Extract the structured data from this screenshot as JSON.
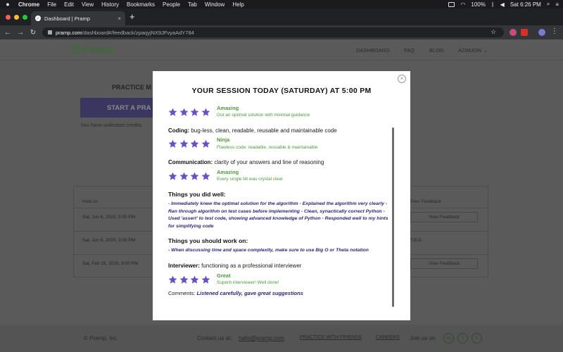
{
  "menubar": {
    "app": "Chrome",
    "items": [
      "File",
      "Edit",
      "View",
      "History",
      "Bookmarks",
      "People",
      "Tab",
      "Window",
      "Help"
    ],
    "battery": "100%",
    "clock": "Sat 6:26 PM"
  },
  "browser": {
    "tab_title": "Dashboard | Pramp",
    "url_host": "pramp.com",
    "url_path": "/dashboard#/feedback/zpaqyjNX9JFvyaAdY784"
  },
  "site": {
    "logo": "Pramp",
    "nav": [
      "DASHBOARD",
      "FAQ",
      "BLOG",
      "AZIMJON"
    ],
    "practice_heading": "PRACTICE M",
    "start_button": "START A PRA",
    "unlimited_text": "You have unlimited credits",
    "table": {
      "headers": [
        "Held on",
        "Peer Feedback"
      ],
      "rows": [
        {
          "date": "Sat, Jun 6, 2020, 5:00 PM",
          "action": "View Feedback"
        },
        {
          "date": "Sat, Jun 6, 2020, 3:00 PM",
          "action": "T.B.D."
        },
        {
          "date": "Sat, Feb 15, 2020, 9:00 PM",
          "action": "View Feedback"
        }
      ]
    },
    "footer": {
      "copyright": "© Pramp, Inc.",
      "contact_label": "Contact us at:",
      "contact_email": "hello@pramp.com",
      "practice_friends": "PRACTICE WITH FRIENDS",
      "careers": "CAREERS",
      "join": "Join us on"
    }
  },
  "modal": {
    "title": "YOUR SESSION TODAY (SATURDAY) AT 5:00 PM",
    "close": "×",
    "ratings": [
      {
        "stars": 4,
        "label": "Amazing",
        "desc": "Got an optimal solution with minimal guidance"
      },
      {
        "criterion_name": "Coding:",
        "criterion_desc": "bug-less, clean, readable, reusable and maintainable code",
        "stars": 4,
        "label": "Ninja",
        "desc": "Flawless code: readable, reusable & maintainable"
      },
      {
        "criterion_name": "Communication:",
        "criterion_desc": "clarity of your answers and line of reasoning",
        "stars": 4,
        "label": "Amazing",
        "desc": "Every single bit was crystal clear"
      }
    ],
    "did_well_title": "Things you did well:",
    "did_well_text": "- Immediately knew the optimal solution for the algorithm - Explained the algorithm very clearly - Ran through algorithm on test cases before implementing - Clean, synactically correct Python - Used 'assert' to test code, showing advanced knowledge of Python - Responded well to my hints for simplifying code",
    "work_on_title": "Things you should work on:",
    "work_on_text": "- When discussing time and space complexity, make sure to use Big O or Theta notation",
    "interviewer": {
      "criterion_name": "Interviewer:",
      "criterion_desc": "functioning as a professional interviewer",
      "stars": 4,
      "label": "Great",
      "desc": "Superb interviewer! Well done!"
    },
    "comments_label": "Comments:",
    "comments_text": "Listened carefully, gave great suggestions"
  },
  "colors": {
    "star": "#6a4fc4",
    "rating_green": "#4a9a3a",
    "feedback_text": "#2d2575"
  }
}
